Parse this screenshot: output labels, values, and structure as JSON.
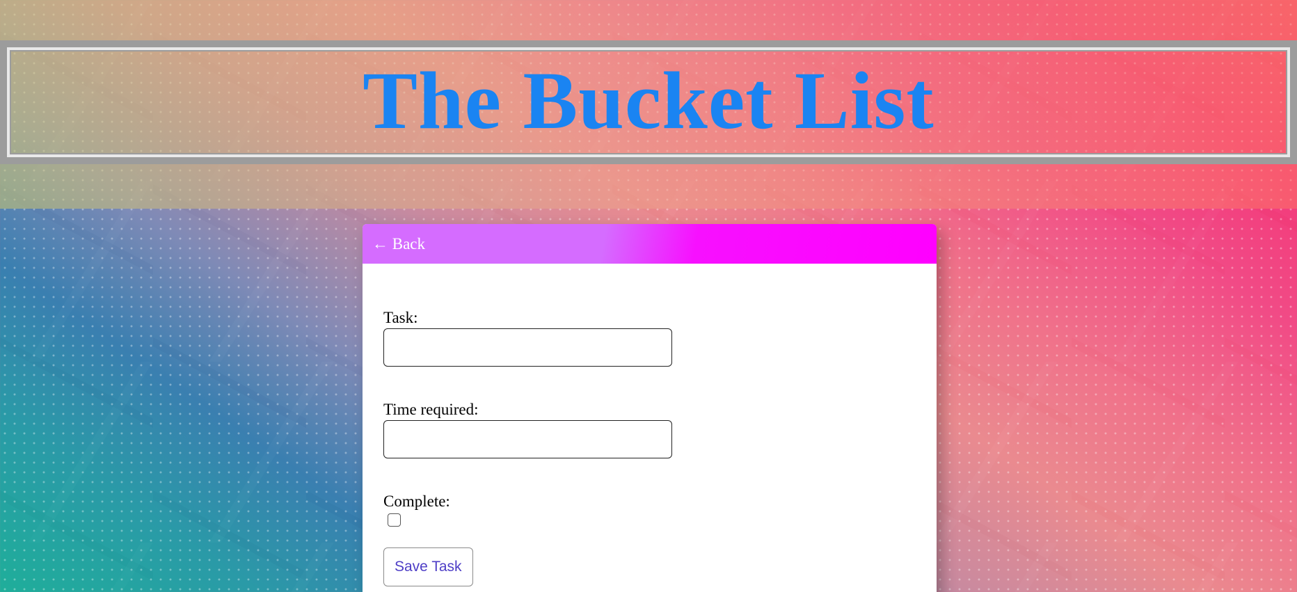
{
  "header": {
    "title": "The Bucket List"
  },
  "card": {
    "back_label": "← Back",
    "task": {
      "label": "Task:",
      "value": ""
    },
    "time": {
      "label": "Time required:",
      "value": ""
    },
    "complete": {
      "label": "Complete:",
      "checked": false
    },
    "save_label": "Save Task"
  },
  "colors": {
    "title": "#1a84f2",
    "card_header_start": "#d56cff",
    "card_header_end": "#ff00ff",
    "save_text": "#4e3ec6"
  }
}
